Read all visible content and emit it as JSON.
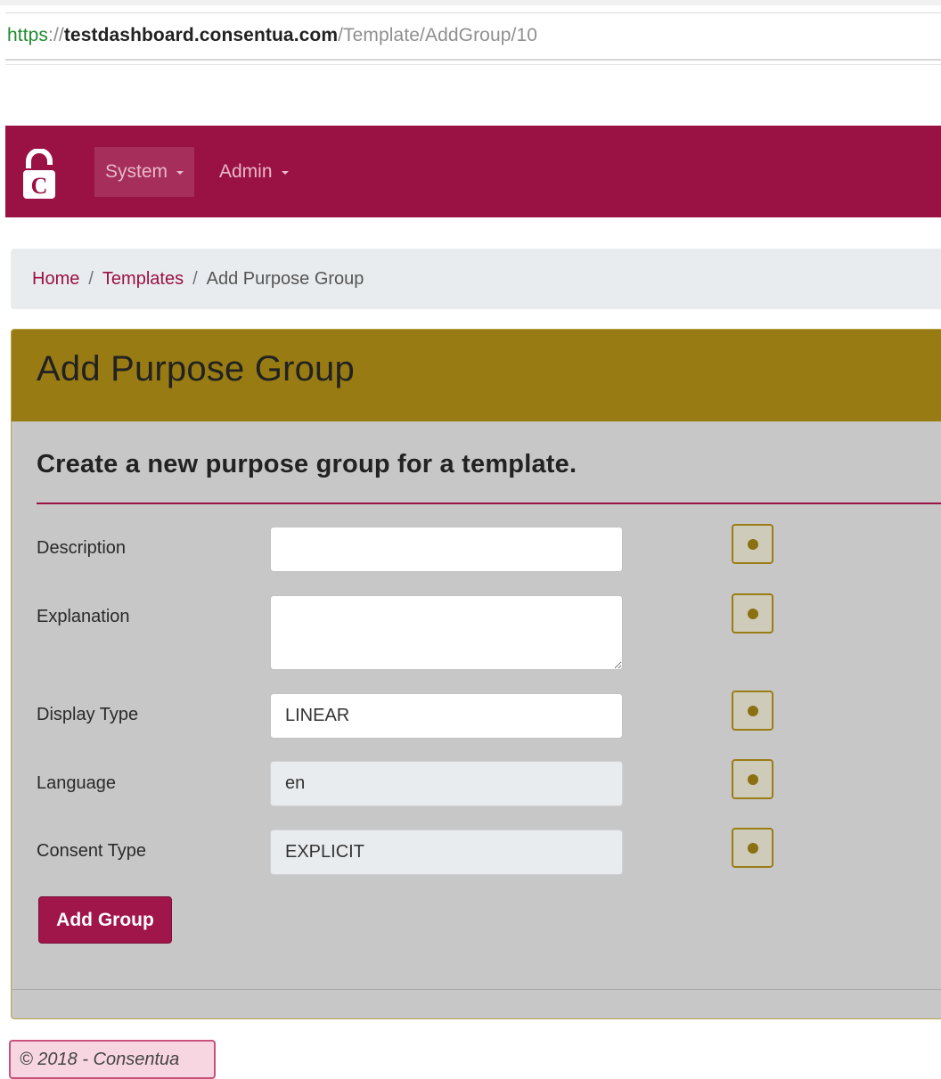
{
  "url": {
    "scheme": "https",
    "separator": "://",
    "host": "testdashboard.consentua.com",
    "path": "/Template/AddGroup/10"
  },
  "navbar": {
    "brand_icon": "padlock-c-logo",
    "items": [
      {
        "label": "System",
        "active": true
      },
      {
        "label": "Admin",
        "active": false
      }
    ],
    "color": "#9a1143"
  },
  "breadcrumb": {
    "items": [
      {
        "label": "Home"
      },
      {
        "label": "Templates"
      },
      {
        "label": "Add Purpose Group"
      }
    ],
    "separator": "/"
  },
  "card": {
    "title": "Add Purpose Group",
    "subtitle": "Create a new purpose group for a template.",
    "header_color": "#987c13",
    "fields": [
      {
        "label": "Description",
        "value": "",
        "readonly": false
      },
      {
        "label": "Explanation",
        "value": "",
        "readonly": false
      },
      {
        "label": "Display Type",
        "value": "LINEAR",
        "readonly": false
      },
      {
        "label": "Language",
        "value": "en",
        "readonly": true
      },
      {
        "label": "Consent Type",
        "value": "EXPLICIT",
        "readonly": true
      }
    ],
    "submit_label": "Add Group",
    "info_icon": "info-icon"
  },
  "footer": {
    "text": "© 2018 - Consentua"
  }
}
